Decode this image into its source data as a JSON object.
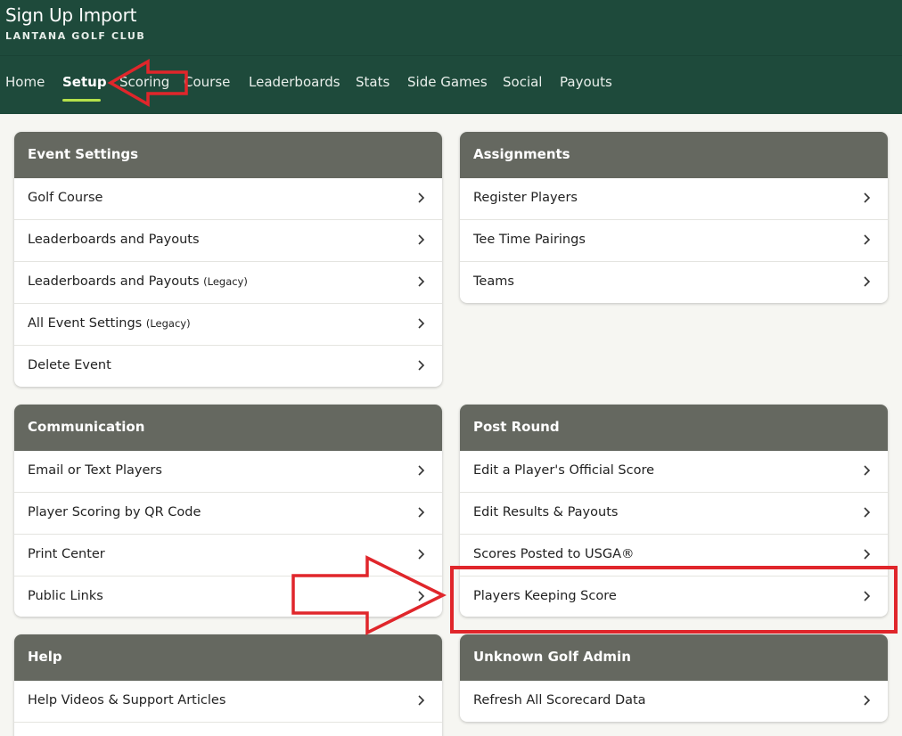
{
  "header": {
    "title": "Sign Up Import",
    "subtitle": "LANTANA GOLF CLUB"
  },
  "nav": {
    "items": [
      "Home",
      "Setup",
      "Scoring",
      "Course",
      "Leaderboards",
      "Stats",
      "Side Games",
      "Social",
      "Payouts"
    ],
    "active": "Setup"
  },
  "cards": {
    "event_settings": {
      "title": "Event Settings",
      "rows": [
        {
          "label": "Golf Course"
        },
        {
          "label": "Leaderboards and Payouts"
        },
        {
          "label": "Leaderboards and Payouts",
          "tag": "(Legacy)"
        },
        {
          "label": "All Event Settings",
          "tag": "(Legacy)"
        },
        {
          "label": "Delete Event"
        }
      ]
    },
    "assignments": {
      "title": "Assignments",
      "rows": [
        {
          "label": "Register Players"
        },
        {
          "label": "Tee Time Pairings"
        },
        {
          "label": "Teams"
        }
      ]
    },
    "communication": {
      "title": "Communication",
      "rows": [
        {
          "label": "Email or Text Players"
        },
        {
          "label": "Player Scoring by QR Code"
        },
        {
          "label": "Print Center"
        },
        {
          "label": "Public Links"
        }
      ]
    },
    "post_round": {
      "title": "Post Round",
      "rows": [
        {
          "label": "Edit a Player's Official Score"
        },
        {
          "label": "Edit Results & Payouts"
        },
        {
          "label": "Scores Posted to USGA®"
        },
        {
          "label": "Players Keeping Score"
        }
      ]
    },
    "help": {
      "title": "Help",
      "rows": [
        {
          "label": "Help Videos & Support Articles"
        },
        {
          "label": ""
        }
      ]
    },
    "unknown_golf_admin": {
      "title": "Unknown Golf Admin",
      "rows": [
        {
          "label": "Refresh All Scorecard Data"
        }
      ]
    }
  },
  "colors": {
    "header_bg": "#1e4a3b",
    "card_header_bg": "#656860",
    "active_underline": "#b5e14b",
    "annotation_red": "#e0262b"
  }
}
